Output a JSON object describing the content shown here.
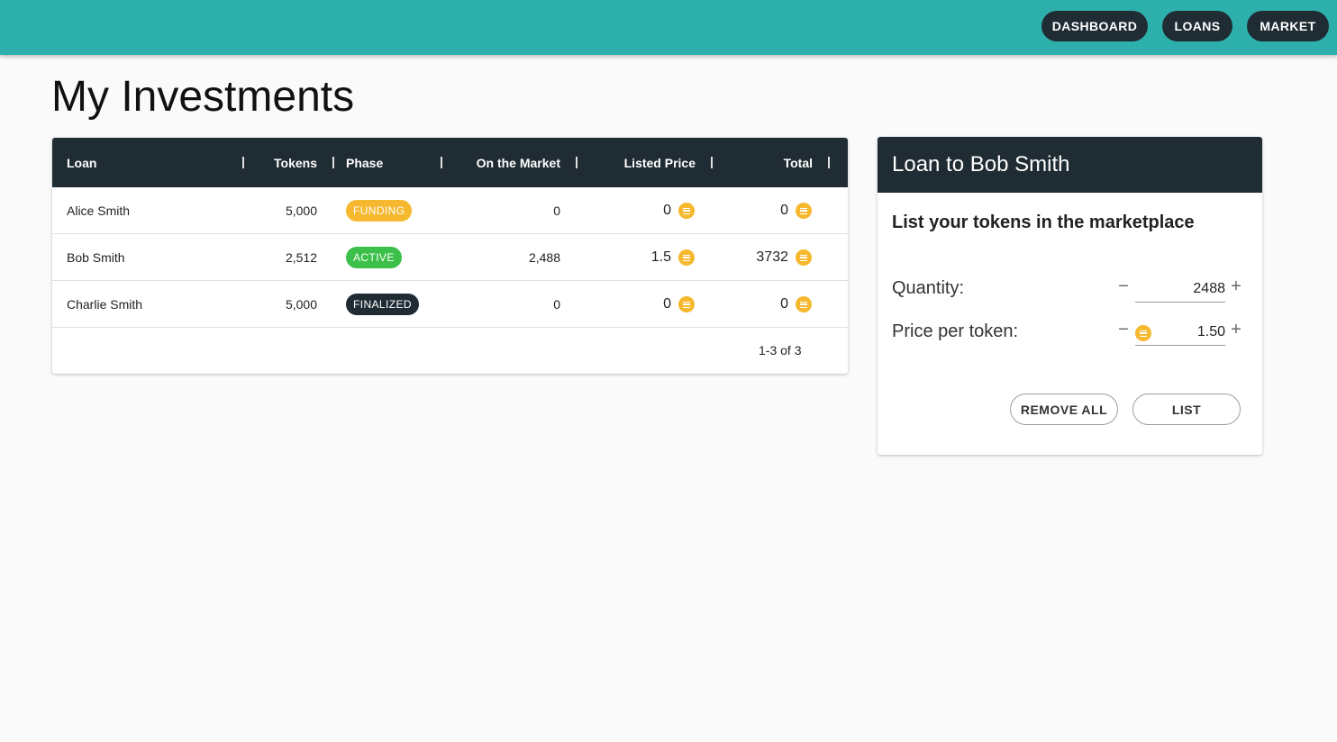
{
  "nav": {
    "dashboard": "DASHBOARD",
    "loans": "LOANS",
    "market": "MARKET"
  },
  "page_title": "My Investments",
  "table": {
    "headers": {
      "loan": "Loan",
      "tokens": "Tokens",
      "phase": "Phase",
      "on_market": "On the Market",
      "listed_price": "Listed Price",
      "total": "Total"
    },
    "rows": [
      {
        "loan": "Alice Smith",
        "tokens": "5,000",
        "phase": "FUNDING",
        "on_market": "0",
        "listed_price": "0",
        "total": "0"
      },
      {
        "loan": "Bob Smith",
        "tokens": "2,512",
        "phase": "ACTIVE",
        "on_market": "2,488",
        "listed_price": "1.5",
        "total": "3732"
      },
      {
        "loan": "Charlie Smith",
        "tokens": "5,000",
        "phase": "FINALIZED",
        "on_market": "0",
        "listed_price": "0",
        "total": "0"
      }
    ],
    "pagination": "1-3 of 3"
  },
  "panel": {
    "title": "Loan to Bob Smith",
    "subtitle": "List your tokens in the marketplace",
    "quantity_label": "Quantity:",
    "quantity_value": "2488",
    "price_label": "Price per token:",
    "price_value": "1.50",
    "remove_all": "REMOVE ALL",
    "list": "LIST"
  },
  "colors": {
    "topbar": "#2db0ab",
    "dark": "#1f2c33",
    "funding": "#f5b82e",
    "active": "#3cc04a",
    "coin": "#f5b82e"
  },
  "icons": {
    "coin": "coin-icon",
    "minus": "minus-icon",
    "plus": "plus-icon"
  }
}
